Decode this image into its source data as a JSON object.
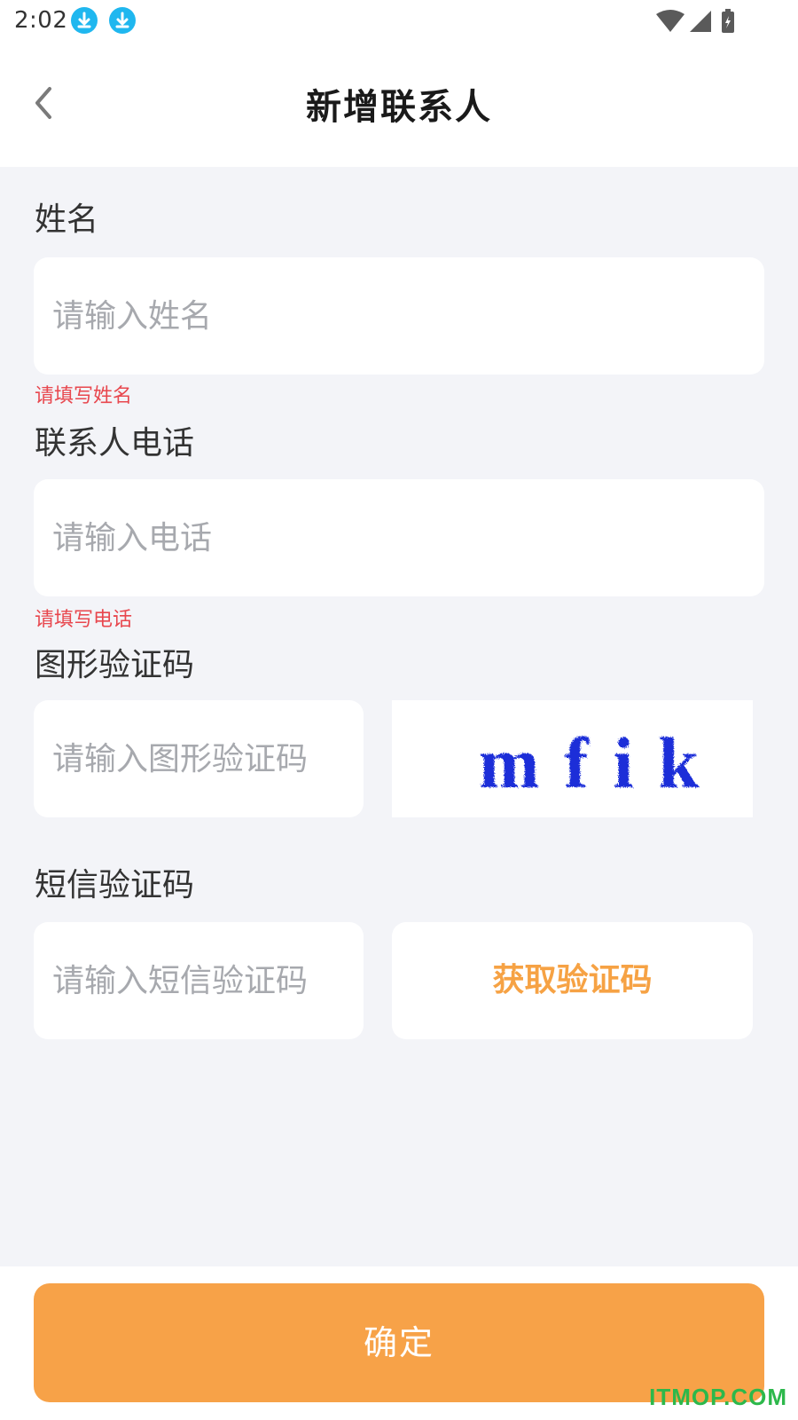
{
  "status_bar": {
    "time": "2:02",
    "icons": [
      "download-icon",
      "download-icon",
      "wifi-icon",
      "cell-signal-icon",
      "battery-icon"
    ]
  },
  "header": {
    "title": "新增联系人",
    "back_icon": "chevron-left-icon"
  },
  "form": {
    "name": {
      "label": "姓名",
      "placeholder": "请输入姓名",
      "value": "",
      "error": "请填写姓名"
    },
    "phone": {
      "label": "联系人电话",
      "placeholder": "请输入电话",
      "value": "",
      "error": "请填写电话"
    },
    "captcha": {
      "label": "图形验证码",
      "placeholder": "请输入图形验证码",
      "value": "",
      "image_text": "mfik"
    },
    "sms": {
      "label": "短信验证码",
      "placeholder": "请输入短信验证码",
      "value": "",
      "get_code_label": "获取验证码"
    }
  },
  "footer": {
    "confirm_label": "确定"
  },
  "watermark": "ITMOP.COM",
  "colors": {
    "accent": "#f7a248",
    "sms_text": "#f6a244",
    "error": "#e8474e",
    "background": "#f3f4f8",
    "captcha_text": "#1a2ed8",
    "download_icon": "#1fb7ef"
  }
}
